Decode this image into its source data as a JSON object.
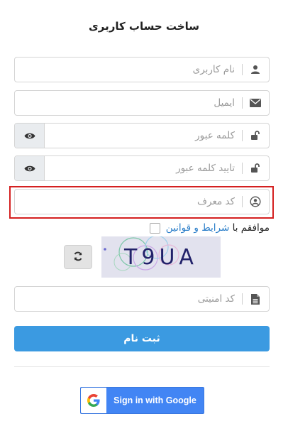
{
  "title": "ساخت حساب کاربری",
  "fields": {
    "username": {
      "placeholder": "نام کاربری",
      "icon": "user-icon"
    },
    "email": {
      "placeholder": "ایمیل",
      "icon": "envelope-icon"
    },
    "password": {
      "placeholder": "کلمه عبور",
      "icon": "unlock-icon",
      "toggle_icon": "eye-icon"
    },
    "password_confirm": {
      "placeholder": "تایید کلمه عبور",
      "icon": "unlock-icon",
      "toggle_icon": "eye-icon"
    },
    "referral": {
      "placeholder": "کد معرف",
      "icon": "user-circle-icon"
    },
    "captcha_code": {
      "placeholder": "کد امنیتی",
      "icon": "file-icon"
    }
  },
  "agree": {
    "prefix": "موافقم با",
    "terms_link": "شرایط",
    "and": "و",
    "rules_link": "قوانین"
  },
  "captcha": {
    "text": "T9UA",
    "refresh_icon": "refresh-icon"
  },
  "submit_label": "ثبت نام",
  "google": {
    "label": "Sign in with Google",
    "icon": "google-logo-icon"
  },
  "colors": {
    "primary": "#3b9ae1",
    "link": "#2a7ec9",
    "google_blue": "#4285f4",
    "highlight_border": "#d42020"
  }
}
